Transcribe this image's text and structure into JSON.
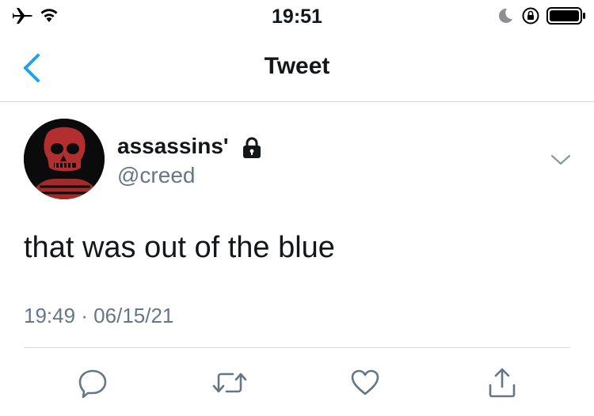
{
  "status_bar": {
    "time": "19:51"
  },
  "nav": {
    "title": "Tweet"
  },
  "tweet": {
    "display_name": "assassins'",
    "handle": "@creed",
    "text": "that was out of the blue",
    "timestamp": "19:49 · 06/15/21"
  },
  "icons": {
    "status": [
      "airplane-icon",
      "wifi-icon",
      "moon-icon",
      "rotation-lock-icon",
      "battery-icon"
    ],
    "actions": [
      "reply-icon",
      "retweet-icon",
      "like-icon",
      "share-icon"
    ]
  },
  "colors": {
    "accent": "#1da1f2",
    "secondary_text": "#657786",
    "primary_text": "#14171a",
    "action_icons": "#657786"
  }
}
